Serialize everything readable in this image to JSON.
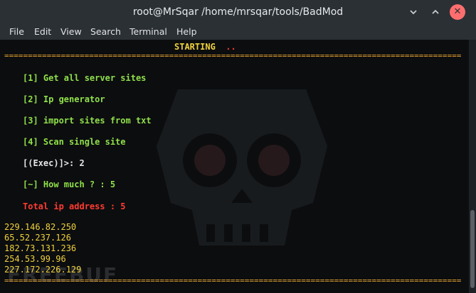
{
  "window": {
    "title": "root@MrSqar /home/mrsqar/tools/BadMod"
  },
  "menu": [
    "File",
    "Edit",
    "View",
    "Search",
    "Terminal",
    "Help"
  ],
  "terminal": {
    "header": "STARTING",
    "header_dots": "..",
    "separator": "=================================================================================================",
    "options": [
      "[1] Get all server sites",
      "[2] Ip generator",
      "[3] import sites from txt",
      "[4] Scan single site"
    ],
    "prompt": "[(Exec)]>: 2",
    "how_much": "[~] How much ? : 5",
    "total": "Total ip address : 5",
    "ips": [
      "229.146.82.250",
      "65.52.237.126",
      "182.73.131.236",
      "254.53.99.96",
      "227.172.226.129"
    ],
    "watermark": "FREEBUF"
  },
  "colors": {
    "yellow": "#f0d23c",
    "green": "#8fe049",
    "red": "#ff3b30",
    "orange": "#f0a020",
    "bg": "#0c0d0f"
  },
  "icons": {
    "minimize": "chevron-down-icon",
    "maximize": "chevron-up-icon",
    "close": "close-icon"
  }
}
